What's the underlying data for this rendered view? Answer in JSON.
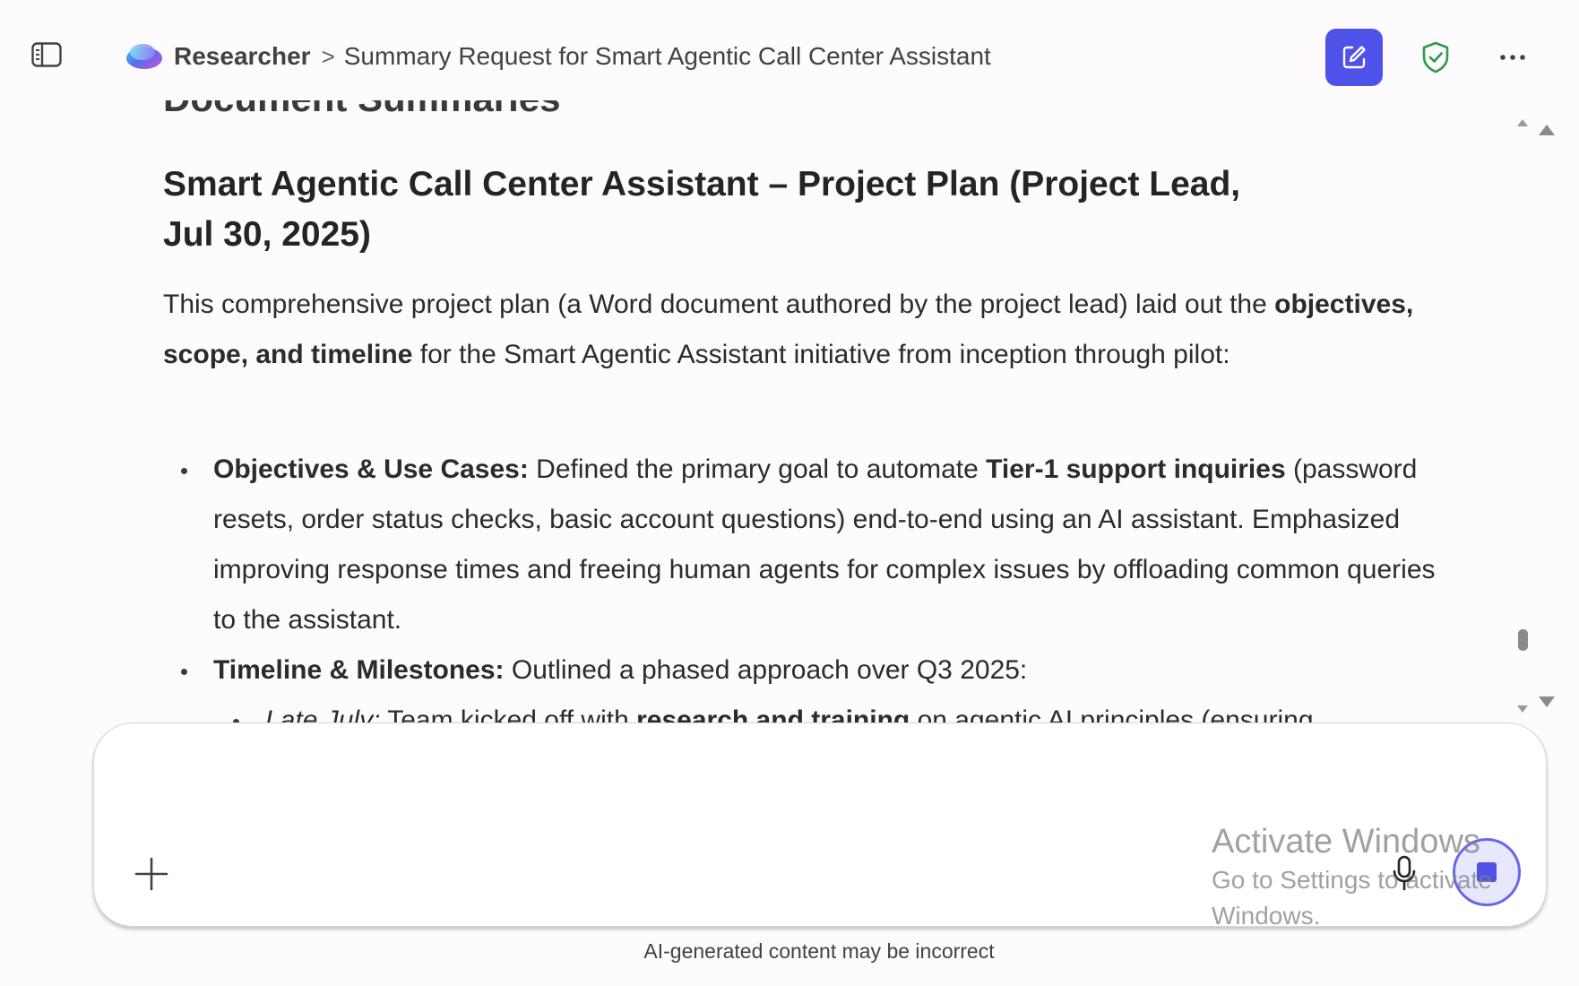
{
  "header": {
    "app_name": "Researcher",
    "separator": ">",
    "conversation_title": "Summary Request for Smart Agentic Call Center Assistant"
  },
  "icons": {
    "sidebar": "sidebar-toggle-icon",
    "brand": "researcher-logo-icon",
    "new_chat": "compose-edit-icon",
    "shield": "shield-check-icon",
    "more": "more-horizontal-icon",
    "add": "plus-icon",
    "mic": "microphone-icon",
    "stop": "stop-icon"
  },
  "colors": {
    "accent": "#4f52e8",
    "shield": "#2e9a4a",
    "background": "#fdfbfd"
  },
  "content": {
    "cut_heading": "Document Summaries",
    "doc_title": "Smart Agentic Call Center Assistant – Project Plan (Project Lead, Jul 30, 2025)",
    "intro": {
      "p1": "This comprehensive project plan (a Word document authored by the project lead) laid out the ",
      "b1": "objectives, scope, and timeline",
      "p2": " for the Smart Agentic Assistant initiative from inception through pilot:"
    },
    "bullets": [
      {
        "label": "Objectives & Use Cases:",
        "t1": " Defined the primary goal to automate ",
        "b1": "Tier-1 support inquiries",
        "t2": " (password resets, order status checks, basic account questions) end-to-end using an AI assistant. Emphasized improving response times and freeing human agents for complex issues by offloading common queries to the assistant."
      },
      {
        "label": "Timeline & Milestones:",
        "t1": " Outlined a phased approach over Q3 2025:"
      }
    ],
    "sub_bullets": [
      {
        "italic": "Late July:",
        "t1": " Team kicked off with ",
        "b1": "research and training",
        "t2": " on agentic AI principles (ensuring"
      }
    ]
  },
  "composer": {
    "placeholder": "",
    "value": ""
  },
  "watermark": {
    "line1": "Activate Windows",
    "line2": "Go to Settings to activate",
    "line3": "Windows."
  },
  "footer": {
    "disclaimer": "AI-generated content may be incorrect"
  }
}
